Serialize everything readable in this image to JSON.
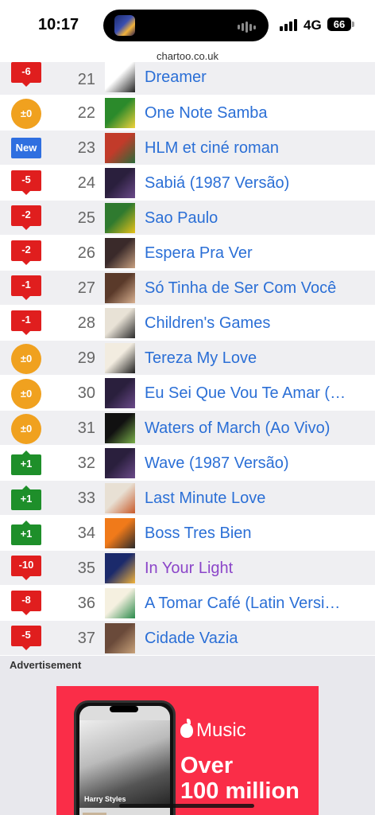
{
  "status_bar": {
    "time": "10:17",
    "network": "4G",
    "battery": "66"
  },
  "browser": {
    "url": "chartoo.co.uk"
  },
  "chart_rows": [
    {
      "change": "-6",
      "type": "down",
      "rank": "21",
      "title": "Dreamer",
      "visited": false,
      "cover": [
        "#ffffff",
        "#222222"
      ]
    },
    {
      "change": "±0",
      "type": "same",
      "rank": "22",
      "title": "One Note Samba",
      "visited": false,
      "cover": [
        "#2b8a2b",
        "#f0d23a"
      ]
    },
    {
      "change": "New",
      "type": "new",
      "rank": "23",
      "title": "HLM et ciné roman",
      "visited": false,
      "cover": [
        "#c23b2a",
        "#2a6b3a"
      ]
    },
    {
      "change": "-5",
      "type": "down",
      "rank": "24",
      "title": "Sabiá (1987 Versão)",
      "visited": false,
      "cover": [
        "#2a1f3d",
        "#6b4a8a"
      ]
    },
    {
      "change": "-2",
      "type": "down",
      "rank": "25",
      "title": "Sao Paulo",
      "visited": false,
      "cover": [
        "#2f7a2f",
        "#e8c21a"
      ]
    },
    {
      "change": "-2",
      "type": "down",
      "rank": "26",
      "title": "Espera Pra Ver",
      "visited": false,
      "cover": [
        "#3a2a2a",
        "#c8a080"
      ]
    },
    {
      "change": "-1",
      "type": "down",
      "rank": "27",
      "title": "Só Tinha de Ser Com Você",
      "visited": false,
      "cover": [
        "#5a3a2a",
        "#d8b090"
      ]
    },
    {
      "change": "-1",
      "type": "down",
      "rank": "28",
      "title": "Children's Games",
      "visited": false,
      "cover": [
        "#e8e2d6",
        "#2a2a2a"
      ]
    },
    {
      "change": "±0",
      "type": "same",
      "rank": "29",
      "title": "Tereza My Love",
      "visited": false,
      "cover": [
        "#f2ece0",
        "#1e1e1e"
      ]
    },
    {
      "change": "±0",
      "type": "same",
      "rank": "30",
      "title": "Eu Sei Que Vou Te Amar (…",
      "visited": false,
      "cover": [
        "#2a1f3d",
        "#6b4a8a"
      ]
    },
    {
      "change": "±0",
      "type": "same",
      "rank": "31",
      "title": "Waters of March (Ao Vivo)",
      "visited": false,
      "cover": [
        "#111111",
        "#7ab04a"
      ]
    },
    {
      "change": "+1",
      "type": "up",
      "rank": "32",
      "title": "Wave (1987 Versão)",
      "visited": false,
      "cover": [
        "#2a1f3d",
        "#6b4a8a"
      ]
    },
    {
      "change": "+1",
      "type": "up",
      "rank": "33",
      "title": "Last Minute Love",
      "visited": false,
      "cover": [
        "#e8e0d4",
        "#c85a2a"
      ]
    },
    {
      "change": "+1",
      "type": "up",
      "rank": "34",
      "title": "Boss Tres Bien",
      "visited": false,
      "cover": [
        "#f07a1a",
        "#2a2a2a"
      ]
    },
    {
      "change": "-10",
      "type": "down",
      "rank": "35",
      "title": "In Your Light",
      "visited": true,
      "cover": [
        "#1b2a6b",
        "#f2b33a"
      ]
    },
    {
      "change": "-8",
      "type": "down",
      "rank": "36",
      "title": "A Tomar Café (Latin Versi…",
      "visited": false,
      "cover": [
        "#f5f0e0",
        "#2a8a4a"
      ]
    },
    {
      "change": "-5",
      "type": "down",
      "rank": "37",
      "title": "Cidade Vazia",
      "visited": false,
      "cover": [
        "#6a4a3a",
        "#c8a27a"
      ]
    }
  ],
  "advertisement": {
    "label": "Advertisement",
    "phone_name": "Harry Styles",
    "brand": "Music",
    "headline_line1": "Over",
    "headline_line2": "100 million"
  },
  "colors": {
    "down": "#e01e1e",
    "up": "#1e8f2a",
    "same": "#f0a11f",
    "new": "#2f6fe0",
    "link": "#2b6fd6",
    "visited": "#8b45c9",
    "ad_bg": "#fa2d48"
  }
}
